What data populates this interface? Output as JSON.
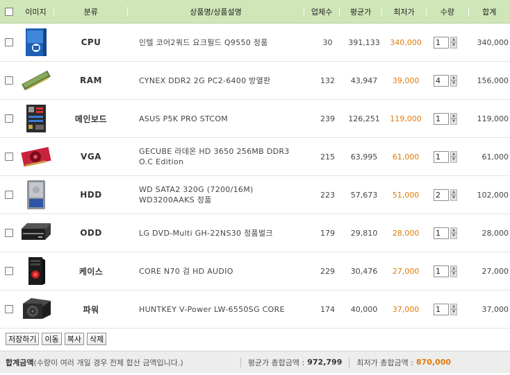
{
  "header": {
    "image": "이미지",
    "category": "분류",
    "name": "상품명/상품설명",
    "vendors": "업체수",
    "avg_price": "평균가",
    "min_price": "최저가",
    "qty": "수량",
    "sum": "합계"
  },
  "items": [
    {
      "category": "CPU",
      "name": "인텔 코어2쿼드 요크필드 Q9550 정품",
      "vendors": "30",
      "avg": "391,133",
      "min": "340,000",
      "qty": "1",
      "sum": "340,000",
      "thumb": "cpu-box"
    },
    {
      "category": "RAM",
      "name": "CYNEX DDR2 2G PC2-6400 방열판",
      "vendors": "132",
      "avg": "43,947",
      "min": "39,000",
      "qty": "4",
      "sum": "156,000",
      "thumb": "ram-stick"
    },
    {
      "category": "메인보드",
      "name": "ASUS P5K PRO STCOM",
      "vendors": "239",
      "avg": "126,251",
      "min": "119,000",
      "qty": "1",
      "sum": "119,000",
      "thumb": "motherboard"
    },
    {
      "category": "VGA",
      "name": "GECUBE 라데온 HD 3650 256MB DDR3 O.C Edition",
      "vendors": "215",
      "avg": "63,995",
      "min": "61,000",
      "qty": "1",
      "sum": "61,000",
      "thumb": "graphics-card"
    },
    {
      "category": "HDD",
      "name": "WD SATA2 320G (7200/16M) WD3200AAKS 정품",
      "vendors": "223",
      "avg": "57,673",
      "min": "51,000",
      "qty": "2",
      "sum": "102,000",
      "thumb": "hard-drive"
    },
    {
      "category": "ODD",
      "name": "LG DVD-Multi GH-22NS30 정품벌크",
      "vendors": "179",
      "avg": "29,810",
      "min": "28,000",
      "qty": "1",
      "sum": "28,000",
      "thumb": "dvd-drive"
    },
    {
      "category": "케이스",
      "name": "CORE N70 검 HD AUDIO",
      "vendors": "229",
      "avg": "30,476",
      "min": "27,000",
      "qty": "1",
      "sum": "27,000",
      "thumb": "pc-case"
    },
    {
      "category": "파워",
      "name": "HUNTKEY V-Power LW-6550SG CORE",
      "vendors": "174",
      "avg": "40,000",
      "min": "37,000",
      "qty": "1",
      "sum": "37,000",
      "thumb": "power-supply"
    }
  ],
  "buttons": {
    "save": "저장하기",
    "move": "이동",
    "copy": "복사",
    "delete": "삭제"
  },
  "totals": {
    "label": "합계금액",
    "note": "(수량이 여러 개일 경우 전체 합산 금액입니다.)",
    "avg_label": "평균가 총합금액 :",
    "avg_value": "972,799",
    "min_label": "최저가 총합금액 :",
    "min_value": "870,000"
  },
  "colors": {
    "header_bg": "#cfe6b8",
    "min_price": "#e07a0a",
    "total_bg": "#ededed"
  }
}
